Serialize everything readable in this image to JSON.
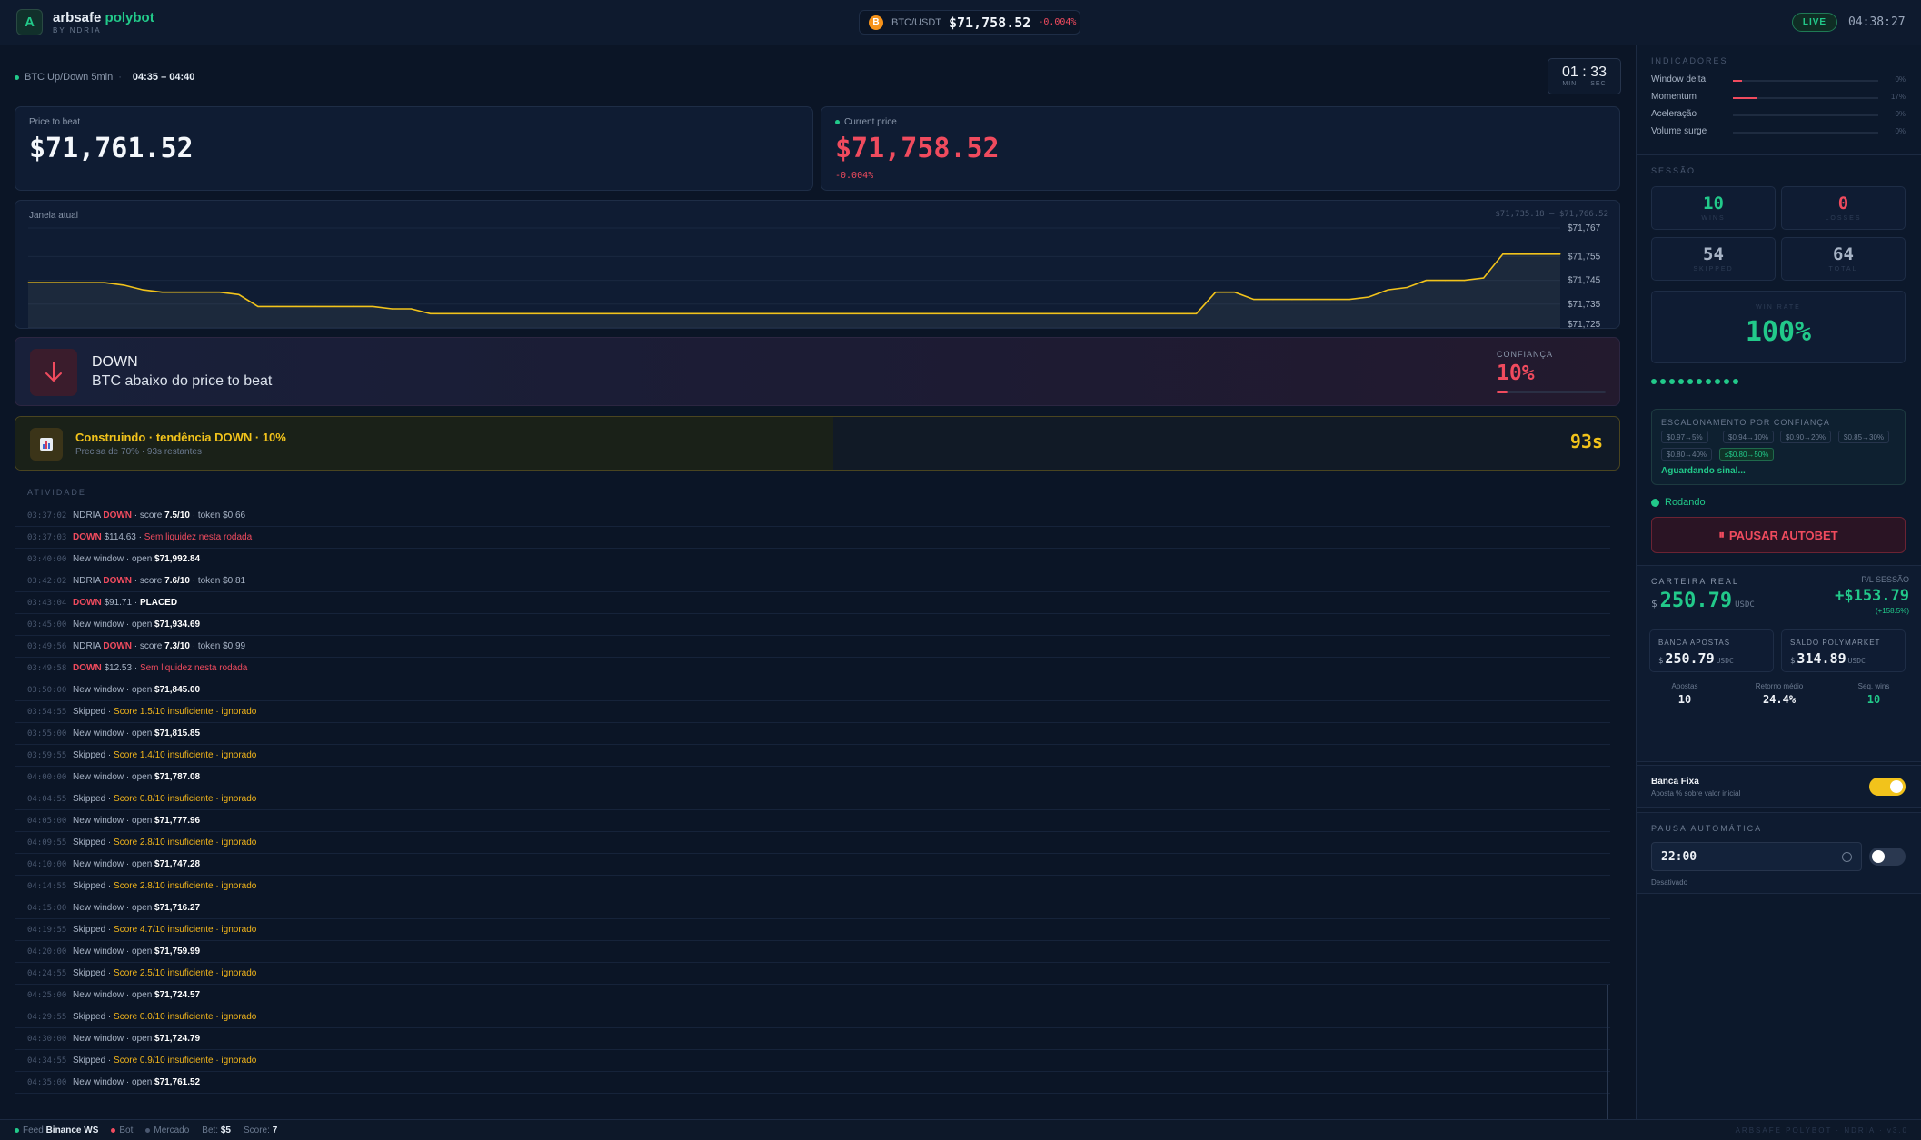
{
  "header": {
    "logo_letter": "A",
    "brand_name": "arbsafe",
    "brand_accent": "polybot",
    "brand_sub": "BY NDRIA",
    "ticker_coin": "B",
    "ticker_pair": "BTC/USDT",
    "ticker_price": "$71,758.52",
    "ticker_change": "-0.004%",
    "live_label": "LIVE",
    "clock": "04:38:27"
  },
  "window": {
    "label": "BTC Up/Down 5min",
    "range": "04:35 – 04:40",
    "timer_min": "01",
    "timer_sep": ":",
    "timer_sec": "33",
    "unit_min": "MIN",
    "unit_sec": "SEC"
  },
  "price_to_beat": {
    "label": "Price to beat",
    "value": "$71,761.52"
  },
  "current_price": {
    "label": "Current price",
    "value": "$71,758.52",
    "change": "-0.004%"
  },
  "chart_data": {
    "type": "line",
    "title": "Janela atual",
    "range_label": "$71,735.18 – $71,766.52",
    "y_ticks": [
      "$71,767",
      "$71,755",
      "$71,745",
      "$71,735",
      "$71,725"
    ],
    "ylim": [
      71725,
      71767
    ],
    "x": [
      0,
      1,
      2,
      3,
      4,
      5,
      6,
      7,
      8,
      9,
      10,
      11,
      12,
      13,
      14,
      15,
      16,
      17,
      18,
      19,
      20,
      21,
      22,
      23,
      24,
      25,
      26,
      27,
      28,
      29,
      30,
      31,
      32,
      33,
      34,
      35,
      36,
      37,
      38,
      39,
      40,
      41,
      42,
      43,
      44,
      45,
      46,
      47,
      48,
      49,
      50,
      51,
      52,
      53,
      54,
      55,
      56,
      57,
      58,
      59,
      60,
      61,
      62,
      63,
      64,
      65,
      66,
      67,
      68,
      69,
      70,
      71,
      72,
      73,
      74,
      75,
      76,
      77,
      78,
      79,
      80
    ],
    "values": [
      71744,
      71744,
      71744,
      71744,
      71744,
      71743,
      71741,
      71740,
      71740,
      71740,
      71740,
      71739,
      71734,
      71734,
      71734,
      71734,
      71734,
      71734,
      71734,
      71733,
      71733,
      71731,
      71731,
      71731,
      71731,
      71731,
      71731,
      71731,
      71731,
      71731,
      71731,
      71731,
      71731,
      71731,
      71731,
      71731,
      71731,
      71731,
      71731,
      71731,
      71731,
      71731,
      71731,
      71731,
      71731,
      71731,
      71731,
      71731,
      71731,
      71731,
      71731,
      71731,
      71731,
      71731,
      71731,
      71731,
      71731,
      71731,
      71731,
      71731,
      71731,
      71731,
      71740,
      71740,
      71737,
      71737,
      71737,
      71737,
      71737,
      71737,
      71738,
      71741,
      71742,
      71745,
      71745,
      71745,
      71746,
      71756,
      71756,
      71756,
      71756
    ],
    "grid": true,
    "color": "#f2c31b"
  },
  "signal": {
    "direction": "DOWN",
    "description": "BTC abaixo do price to beat",
    "confidence_label": "CONFIANÇA",
    "confidence_value": "10%",
    "confidence_fraction": 0.1
  },
  "build": {
    "icon": "chart-icon",
    "title": "Construindo · tendência DOWN · 10%",
    "subtitle": "Precisa de 70% · 93s restantes",
    "seconds": "93s",
    "progress_fraction": 0.51
  },
  "activity": {
    "heading": "ATIVIDADE",
    "rows": [
      {
        "ts": "03:37:02",
        "p": [
          {
            "t": "NDRIA "
          },
          {
            "t": "DOWN",
            "c": "dn"
          },
          {
            "t": " · score "
          },
          {
            "t": "7.5/10",
            "c": "w"
          },
          {
            "t": " · token $0.66"
          }
        ]
      },
      {
        "ts": "03:37:03",
        "p": [
          {
            "t": "DOWN",
            "c": "dn"
          },
          {
            "t": " $114.63 · "
          },
          {
            "t": "Sem liquidez nesta rodada",
            "c": "warn"
          }
        ]
      },
      {
        "ts": "03:40:00",
        "p": [
          {
            "t": "New window · open "
          },
          {
            "t": "$71,992.84",
            "c": "w"
          }
        ]
      },
      {
        "ts": "03:42:02",
        "p": [
          {
            "t": "NDRIA "
          },
          {
            "t": "DOWN",
            "c": "dn"
          },
          {
            "t": " · score "
          },
          {
            "t": "7.6/10",
            "c": "w"
          },
          {
            "t": " · token $0.81"
          }
        ]
      },
      {
        "ts": "03:43:04",
        "p": [
          {
            "t": "DOWN",
            "c": "dn"
          },
          {
            "t": " $91.71 · "
          },
          {
            "t": "PLACED",
            "c": "w"
          }
        ]
      },
      {
        "ts": "03:45:00",
        "p": [
          {
            "t": "New window · open "
          },
          {
            "t": "$71,934.69",
            "c": "w"
          }
        ]
      },
      {
        "ts": "03:49:56",
        "p": [
          {
            "t": "NDRIA "
          },
          {
            "t": "DOWN",
            "c": "dn"
          },
          {
            "t": " · score "
          },
          {
            "t": "7.3/10",
            "c": "w"
          },
          {
            "t": " · token $0.99"
          }
        ]
      },
      {
        "ts": "03:49:58",
        "p": [
          {
            "t": "DOWN",
            "c": "dn"
          },
          {
            "t": " $12.53 · "
          },
          {
            "t": "Sem liquidez nesta rodada",
            "c": "warn"
          }
        ]
      },
      {
        "ts": "03:50:00",
        "p": [
          {
            "t": "New window · open "
          },
          {
            "t": "$71,845.00",
            "c": "w"
          }
        ]
      },
      {
        "ts": "03:54:55",
        "p": [
          {
            "t": "Skipped · "
          },
          {
            "t": "Score 1.5/10 insuficiente · ignorado",
            "c": "amb"
          }
        ]
      },
      {
        "ts": "03:55:00",
        "p": [
          {
            "t": "New window · open "
          },
          {
            "t": "$71,815.85",
            "c": "w"
          }
        ]
      },
      {
        "ts": "03:59:55",
        "p": [
          {
            "t": "Skipped · "
          },
          {
            "t": "Score 1.4/10 insuficiente · ignorado",
            "c": "amb"
          }
        ]
      },
      {
        "ts": "04:00:00",
        "p": [
          {
            "t": "New window · open "
          },
          {
            "t": "$71,787.08",
            "c": "w"
          }
        ]
      },
      {
        "ts": "04:04:55",
        "p": [
          {
            "t": "Skipped · "
          },
          {
            "t": "Score 0.8/10 insuficiente · ignorado",
            "c": "amb"
          }
        ]
      },
      {
        "ts": "04:05:00",
        "p": [
          {
            "t": "New window · open "
          },
          {
            "t": "$71,777.96",
            "c": "w"
          }
        ]
      },
      {
        "ts": "04:09:55",
        "p": [
          {
            "t": "Skipped · "
          },
          {
            "t": "Score 2.8/10 insuficiente · ignorado",
            "c": "amb"
          }
        ]
      },
      {
        "ts": "04:10:00",
        "p": [
          {
            "t": "New window · open "
          },
          {
            "t": "$71,747.28",
            "c": "w"
          }
        ]
      },
      {
        "ts": "04:14:55",
        "p": [
          {
            "t": "Skipped · "
          },
          {
            "t": "Score 2.8/10 insuficiente · ignorado",
            "c": "amb"
          }
        ]
      },
      {
        "ts": "04:15:00",
        "p": [
          {
            "t": "New window · open "
          },
          {
            "t": "$71,716.27",
            "c": "w"
          }
        ]
      },
      {
        "ts": "04:19:55",
        "p": [
          {
            "t": "Skipped · "
          },
          {
            "t": "Score 4.7/10 insuficiente · ignorado",
            "c": "amb"
          }
        ]
      },
      {
        "ts": "04:20:00",
        "p": [
          {
            "t": "New window · open "
          },
          {
            "t": "$71,759.99",
            "c": "w"
          }
        ]
      },
      {
        "ts": "04:24:55",
        "p": [
          {
            "t": "Skipped · "
          },
          {
            "t": "Score 2.5/10 insuficiente · ignorado",
            "c": "amb"
          }
        ]
      },
      {
        "ts": "04:25:00",
        "p": [
          {
            "t": "New window · open "
          },
          {
            "t": "$71,724.57",
            "c": "w"
          }
        ]
      },
      {
        "ts": "04:29:55",
        "p": [
          {
            "t": "Skipped · "
          },
          {
            "t": "Score 0.0/10 insuficiente · ignorado",
            "c": "amb"
          }
        ]
      },
      {
        "ts": "04:30:00",
        "p": [
          {
            "t": "New window · open "
          },
          {
            "t": "$71,724.79",
            "c": "w"
          }
        ]
      },
      {
        "ts": "04:34:55",
        "p": [
          {
            "t": "Skipped · "
          },
          {
            "t": "Score 0.9/10 insuficiente · ignorado",
            "c": "amb"
          }
        ]
      },
      {
        "ts": "04:35:00",
        "p": [
          {
            "t": "New window · open "
          },
          {
            "t": "$71,761.52",
            "c": "w"
          }
        ]
      }
    ]
  },
  "footer": {
    "feed_label": "Feed",
    "feed_value": "Binance WS",
    "bot_label": "Bot",
    "market_label": "Mercado",
    "bet_label": "Bet:",
    "bet_value": "$5",
    "score_label": "Score:",
    "score_value": "7",
    "version": "ARBSAFE POLYBOT · NDRIA · v3.0"
  },
  "indicators": {
    "heading": "INDICADORES",
    "items": [
      {
        "name": "Window delta",
        "pct": "0%",
        "fraction": 0.06
      },
      {
        "name": "Momentum",
        "pct": "17%",
        "fraction": 0.17
      },
      {
        "name": "Aceleração",
        "pct": "0%",
        "fraction": 0
      },
      {
        "name": "Volume surge",
        "pct": "0%",
        "fraction": 0
      }
    ]
  },
  "session": {
    "heading": "SESSÃO",
    "wins": "10",
    "wins_label": "WINS",
    "losses": "0",
    "losses_label": "LOSSES",
    "skipped": "54",
    "skipped_label": "SKIPPED",
    "total": "64",
    "total_label": "TOTAL",
    "winrate_label": "WIN RATE",
    "winrate": "100%",
    "streak_count": 10
  },
  "scaling": {
    "heading": "ESCALONAMENTO POR CONFIANÇA",
    "chips": [
      "$0.97→5%",
      "$0.94→10%",
      "$0.90→20%",
      "$0.85→30%",
      "$0.80→40%",
      "≤$0.80→50%"
    ],
    "status": "Aguardando sinal..."
  },
  "autobet": {
    "status": "Rodando",
    "pause_label": "PAUSAR AUTOBET",
    "pause_icon": "⏸"
  },
  "wallet": {
    "heading": "CARTEIRA REAL",
    "currency": "$",
    "balance": "250.79",
    "unit": "USDC",
    "pl_label": "P/L SESSÃO",
    "pl_value": "+$153.79",
    "pl_pct": "(+158.5%)",
    "banca_label": "BANCA APOSTAS",
    "banca_value": "250.79",
    "saldo_label": "SALDO POLYMARKET",
    "saldo_value": "314.89",
    "apostas_label": "Apostas",
    "apostas_value": "10",
    "retorno_label": "Retorno médio",
    "retorno_value": "24.4%",
    "seq_label": "Seq. wins",
    "seq_value": "10"
  },
  "banca_fixa": {
    "title": "Banca Fixa",
    "subtitle": "Aposta % sobre valor inicial",
    "enabled": true
  },
  "pausa": {
    "heading": "PAUSA AUTOMÁTICA",
    "time": "22:00",
    "status": "Desativado",
    "enabled": false
  },
  "colors": {
    "accent": "#22c98a",
    "down": "#f04b5e",
    "warn": "#f2c31b",
    "bg": "#0b1526"
  }
}
